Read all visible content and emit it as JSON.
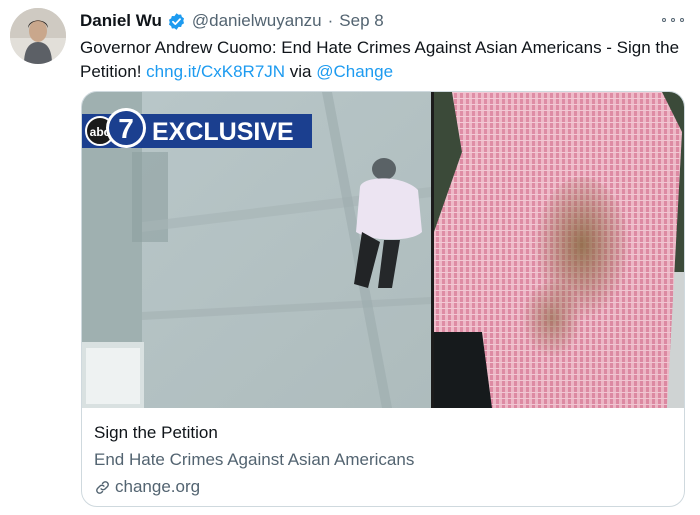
{
  "author": {
    "name": "Daniel Wu",
    "handle": "@danielwuyanzu",
    "separator": "·",
    "time": "Sep 8"
  },
  "tweet": {
    "text_before": "Governor Andrew Cuomo: End Hate Crimes Against Asian Americans - Sign the Petition! ",
    "link": "chng.it/CxK8R7JN",
    "text_middle": " via ",
    "mention": "@Change"
  },
  "card": {
    "image_overlay_brand": "abc",
    "image_overlay_channel": "7",
    "image_overlay_label": "EXCLUSIVE",
    "title": "Sign the Petition",
    "description": "End Hate Crimes Against Asian Americans",
    "domain": "change.org"
  },
  "icons": {
    "verified": "verified-badge-icon",
    "more": "more-options-icon",
    "link": "link-icon"
  },
  "colors": {
    "link": "#1d9bf0",
    "secondary_text": "#536471",
    "verified": "#1d9bf0",
    "abc_banner": "#1b3f8f"
  }
}
